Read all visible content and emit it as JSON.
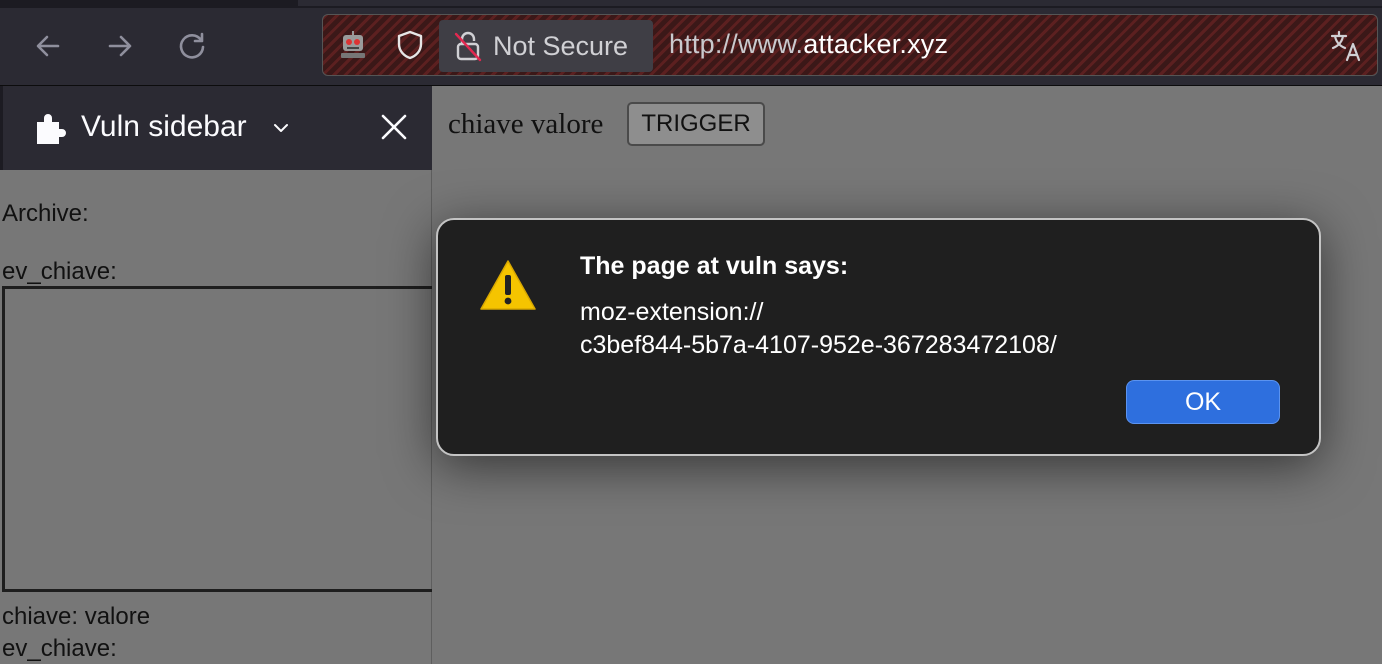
{
  "browser": {
    "security_label": "Not Secure",
    "url_scheme": "http://www.",
    "url_host": "attacker.xyz",
    "icons": [
      "back-icon",
      "forward-icon",
      "reload-icon",
      "robot-icon",
      "shield-icon",
      "insecure-lock-icon",
      "translate-icon"
    ]
  },
  "sidebar": {
    "title": "Vuln sidebar",
    "archive_label": "Archive:",
    "ev_label_1": "ev_chiave:",
    "entry_text": "chiave: valore",
    "ev_label_2": "ev_chiave:"
  },
  "page": {
    "kv_text": "chiave valore",
    "trigger_label": "TRIGGER"
  },
  "dialog": {
    "heading": "The page at vuln says:",
    "message": "moz-extension://\nc3bef844-5b7a-4107-952e-367283472108/",
    "ok_label": "OK"
  },
  "colors": {
    "toolbar": "#2b2a33",
    "dialog_bg": "#1f1f1f",
    "ok_button": "#2e6fde",
    "page_bg": "#777777"
  }
}
